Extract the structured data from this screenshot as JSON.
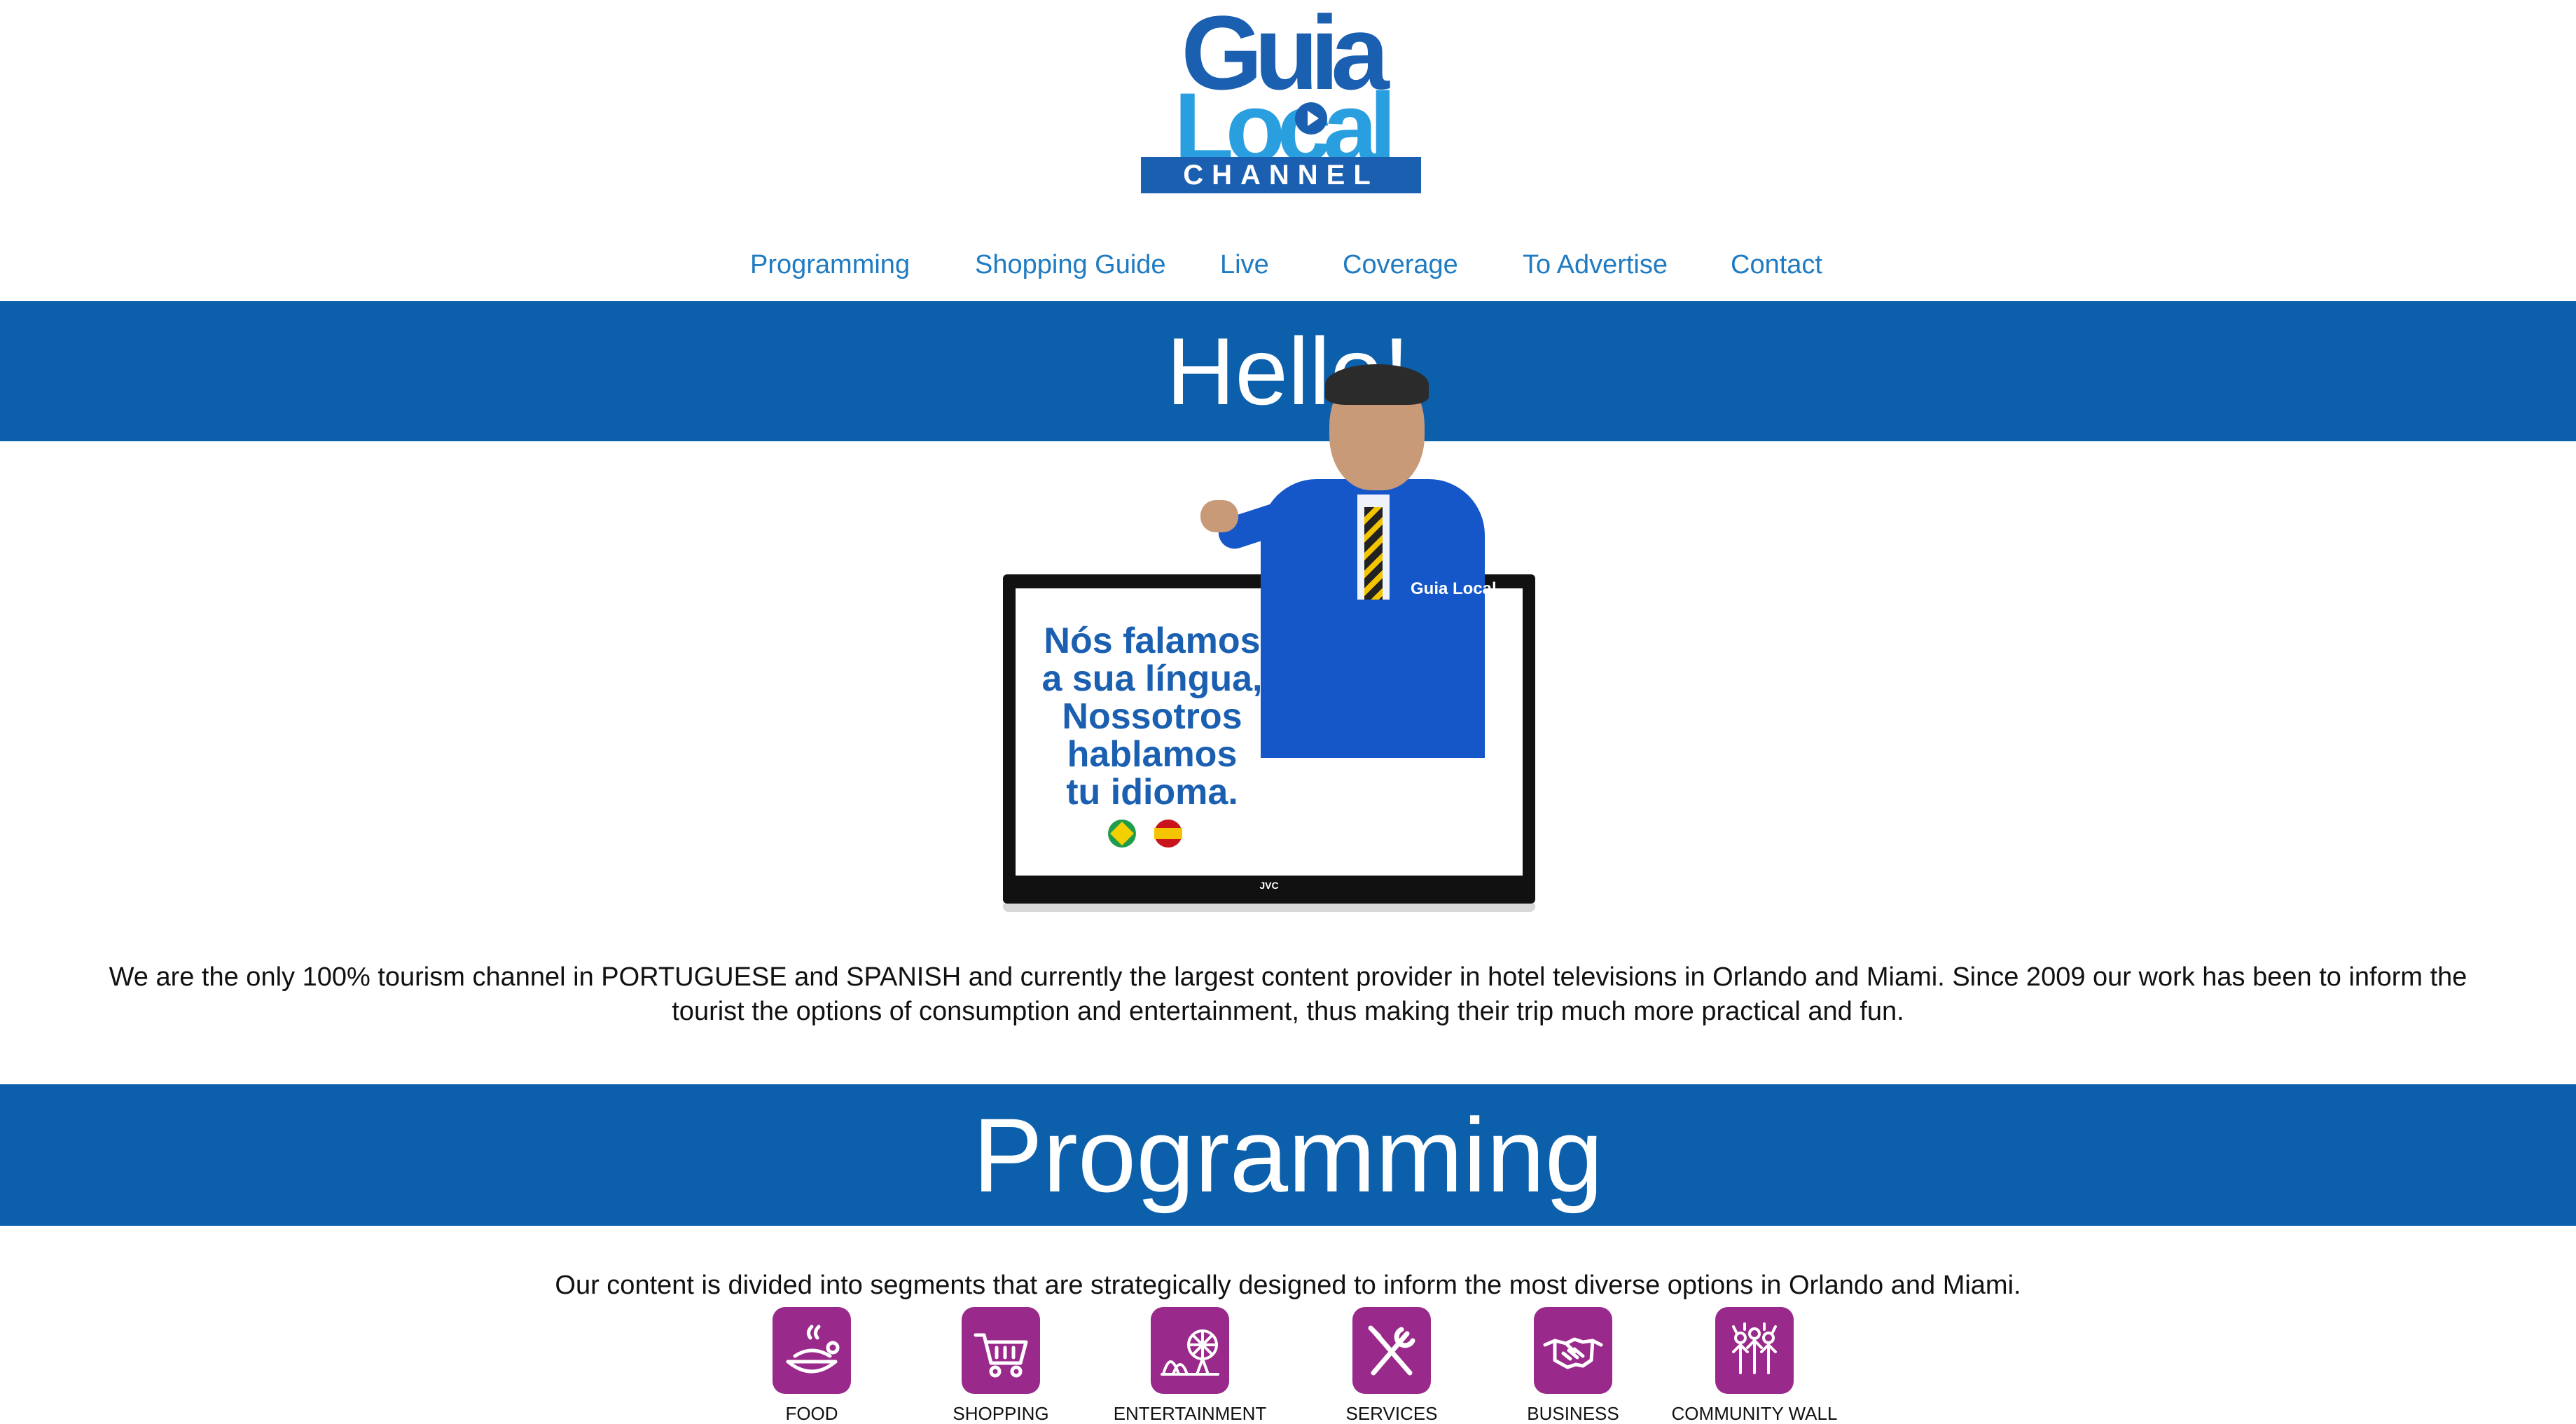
{
  "logo": {
    "line1": "Guia",
    "line2": "Local",
    "line3": "CHANNEL"
  },
  "nav": {
    "items": [
      {
        "label": "Programming"
      },
      {
        "label": "Shopping Guide"
      },
      {
        "label": "Live"
      },
      {
        "label": "Coverage"
      },
      {
        "label": "To Advertise"
      },
      {
        "label": "Contact"
      }
    ]
  },
  "hello": {
    "title": "Hello!",
    "tv_text_lines": [
      "Nós falamos",
      "a sua língua,",
      "Nossotros",
      "hablamos",
      "tu idioma."
    ],
    "tv_brand": "JVC",
    "badge_text": "Guia Local",
    "paragraph": "We are the only 100% tourism channel in PORTUGUESE and SPANISH and currently the largest content provider in hotel televisions in Orlando and Miami. Since 2009 our work has been to inform the tourist the options of consumption and entertainment, thus making their trip much more practical and fun."
  },
  "programming": {
    "title": "Programming",
    "intro": "Our content is divided into segments that are strategically designed to inform the most diverse options in Orlando and Miami.",
    "categories": [
      {
        "label": "FOOD",
        "icon": "food-icon"
      },
      {
        "label": "SHOPPING",
        "icon": "cart-icon"
      },
      {
        "label": "ENTERTAINMENT",
        "icon": "ferris-wheel-icon"
      },
      {
        "label": "SERVICES",
        "icon": "tools-icon"
      },
      {
        "label": "BUSINESS",
        "icon": "handshake-icon"
      },
      {
        "label": "COMMUNITY WALL",
        "icon": "community-icon"
      }
    ]
  },
  "colors": {
    "brand_blue": "#0c5faa",
    "nav_blue": "#1f7bc2",
    "category_purple": "#99298a"
  }
}
